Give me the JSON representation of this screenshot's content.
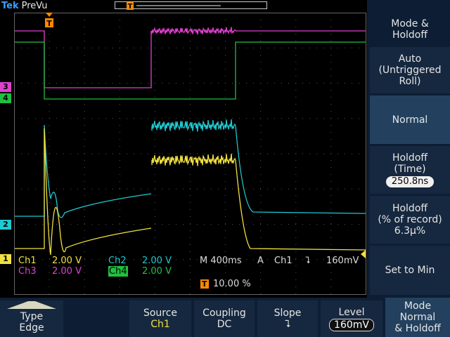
{
  "header": {
    "brand": "Tek",
    "mode": "PreVu"
  },
  "channels": {
    "ch1": {
      "label": "Ch1",
      "scale": "2.00 V",
      "marker": "1",
      "color": "#f0e040"
    },
    "ch2": {
      "label": "Ch2",
      "scale": "2.00 V",
      "marker": "2",
      "color": "#20c8d0"
    },
    "ch3": {
      "label": "Ch3",
      "scale": "2.00 V",
      "marker": "3",
      "color": "#e040d0"
    },
    "ch4": {
      "label": "Ch4",
      "scale": "2.00 V",
      "marker": "4",
      "color": "#20c040"
    }
  },
  "timebase": {
    "label": "M 400ms",
    "trigger_mode": "A",
    "trigger_source": "Ch1",
    "trigger_level": "160mV",
    "position": "10.00 %",
    "trigger_marker": "T"
  },
  "side_menu": {
    "title": "Mode &\nHoldoff",
    "auto": "Auto\n(Untriggered\nRoll)",
    "normal": "Normal",
    "holdoff_time_label": "Holdoff\n(Time)",
    "holdoff_time_value": "250.8ns",
    "holdoff_pct_label": "Holdoff\n(% of record)",
    "holdoff_pct_value": "6.3µ%",
    "set_to_min": "Set to Min"
  },
  "bottom_menu": {
    "type_label": "Type",
    "type_value": "Edge",
    "source_label": "Source",
    "source_value": "Ch1",
    "coupling_label": "Coupling",
    "coupling_value": "DC",
    "slope_label": "Slope",
    "slope_value": "⮧",
    "level_label": "Level",
    "level_value": "160mV",
    "mode_label": "Mode\nNormal\n& Holdoff"
  }
}
